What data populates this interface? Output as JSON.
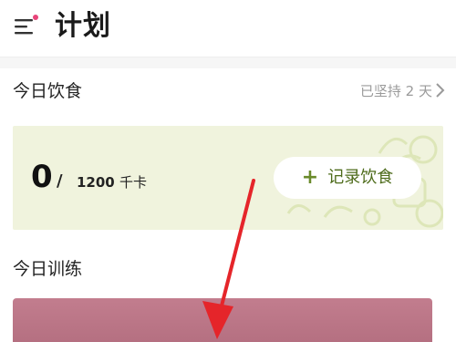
{
  "header": {
    "title": "计划",
    "menu_icon": "menu-icon",
    "notification_dot_color": "#e8457a"
  },
  "diet": {
    "section_title": "今日饮食",
    "streak_text": "已坚持 2 天",
    "calories_consumed": "0",
    "separator": "/",
    "calories_goal": "1200",
    "calories_unit": "千卡",
    "record_button_label": "记录饮食",
    "card_color": "#f0f3dd",
    "accent_color": "#6a8a2a"
  },
  "training": {
    "section_title": "今日训练",
    "card_color": "#c27d8e"
  },
  "annotation": {
    "arrow_color": "#e5252a"
  }
}
